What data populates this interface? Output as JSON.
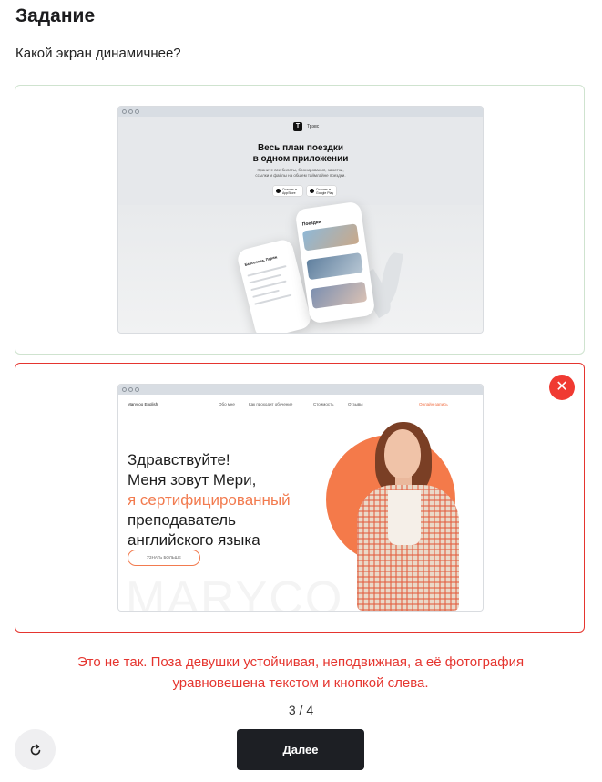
{
  "task": {
    "title": "Задание",
    "question": "Какой экран динамичнее?"
  },
  "options": [
    {
      "state": "neutral",
      "preview": {
        "logo_letter": "T",
        "logo_text": "Трэвс",
        "headline_line1": "Весь план поездки",
        "headline_line2": "в одном приложении",
        "sub_line1": "Храните все билеты, бронирования, заметки,",
        "sub_line2": "ссылки и файлы на общем таймлайне поездки.",
        "store_apple": "Скачать в AppStore",
        "store_google": "Скачать в Google Play",
        "phone_title": "Поездки",
        "phone_small_title": "Барселона, Париж"
      }
    },
    {
      "state": "wrong",
      "preview": {
        "brand": "Marycoo English",
        "nav": [
          "Обо мне",
          "Как проходит обучение",
          "Стоимость",
          "Отзывы"
        ],
        "cta": "Онлайн-запись",
        "headline_line1": "Здравствуйте!",
        "headline_line2": "Меня зовут Мери,",
        "headline_line3": "я сертифицированный",
        "headline_line4": "преподаватель",
        "headline_line5": "английского языка",
        "button": "УЗНАТЬ БОЛЬШЕ",
        "watermark": "MARYCO"
      }
    }
  ],
  "feedback": {
    "line1": "Это не так. Поза девушки устойчивая, неподвижная, а её фотография",
    "line2": "уравновешена текстом и кнопкой слева."
  },
  "progress": "3 / 4",
  "actions": {
    "next_label": "Далее",
    "reset_icon": "refresh-icon",
    "wrong_icon": "close-icon"
  },
  "colors": {
    "error": "#e5352f",
    "accent_orange": "#f47a4a",
    "dark_button": "#1d1f24"
  }
}
